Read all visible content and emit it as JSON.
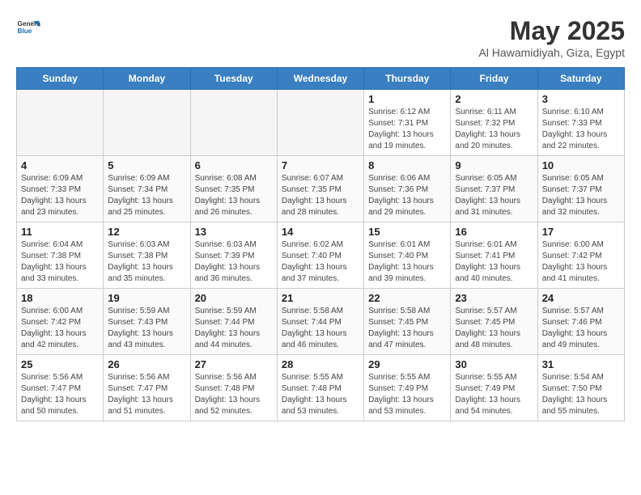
{
  "header": {
    "logo_general": "General",
    "logo_blue": "Blue",
    "month_title": "May 2025",
    "location": "Al Hawamidiyah, Giza, Egypt"
  },
  "weekdays": [
    "Sunday",
    "Monday",
    "Tuesday",
    "Wednesday",
    "Thursday",
    "Friday",
    "Saturday"
  ],
  "weeks": [
    [
      {
        "day": "",
        "empty": true
      },
      {
        "day": "",
        "empty": true
      },
      {
        "day": "",
        "empty": true
      },
      {
        "day": "",
        "empty": true
      },
      {
        "day": "1",
        "sunrise": "6:12 AM",
        "sunset": "7:31 PM",
        "daylight": "13 hours and 19 minutes."
      },
      {
        "day": "2",
        "sunrise": "6:11 AM",
        "sunset": "7:32 PM",
        "daylight": "13 hours and 20 minutes."
      },
      {
        "day": "3",
        "sunrise": "6:10 AM",
        "sunset": "7:33 PM",
        "daylight": "13 hours and 22 minutes."
      }
    ],
    [
      {
        "day": "4",
        "sunrise": "6:09 AM",
        "sunset": "7:33 PM",
        "daylight": "13 hours and 23 minutes."
      },
      {
        "day": "5",
        "sunrise": "6:09 AM",
        "sunset": "7:34 PM",
        "daylight": "13 hours and 25 minutes."
      },
      {
        "day": "6",
        "sunrise": "6:08 AM",
        "sunset": "7:35 PM",
        "daylight": "13 hours and 26 minutes."
      },
      {
        "day": "7",
        "sunrise": "6:07 AM",
        "sunset": "7:35 PM",
        "daylight": "13 hours and 28 minutes."
      },
      {
        "day": "8",
        "sunrise": "6:06 AM",
        "sunset": "7:36 PM",
        "daylight": "13 hours and 29 minutes."
      },
      {
        "day": "9",
        "sunrise": "6:05 AM",
        "sunset": "7:37 PM",
        "daylight": "13 hours and 31 minutes."
      },
      {
        "day": "10",
        "sunrise": "6:05 AM",
        "sunset": "7:37 PM",
        "daylight": "13 hours and 32 minutes."
      }
    ],
    [
      {
        "day": "11",
        "sunrise": "6:04 AM",
        "sunset": "7:38 PM",
        "daylight": "13 hours and 33 minutes."
      },
      {
        "day": "12",
        "sunrise": "6:03 AM",
        "sunset": "7:38 PM",
        "daylight": "13 hours and 35 minutes."
      },
      {
        "day": "13",
        "sunrise": "6:03 AM",
        "sunset": "7:39 PM",
        "daylight": "13 hours and 36 minutes."
      },
      {
        "day": "14",
        "sunrise": "6:02 AM",
        "sunset": "7:40 PM",
        "daylight": "13 hours and 37 minutes."
      },
      {
        "day": "15",
        "sunrise": "6:01 AM",
        "sunset": "7:40 PM",
        "daylight": "13 hours and 39 minutes."
      },
      {
        "day": "16",
        "sunrise": "6:01 AM",
        "sunset": "7:41 PM",
        "daylight": "13 hours and 40 minutes."
      },
      {
        "day": "17",
        "sunrise": "6:00 AM",
        "sunset": "7:42 PM",
        "daylight": "13 hours and 41 minutes."
      }
    ],
    [
      {
        "day": "18",
        "sunrise": "6:00 AM",
        "sunset": "7:42 PM",
        "daylight": "13 hours and 42 minutes."
      },
      {
        "day": "19",
        "sunrise": "5:59 AM",
        "sunset": "7:43 PM",
        "daylight": "13 hours and 43 minutes."
      },
      {
        "day": "20",
        "sunrise": "5:59 AM",
        "sunset": "7:44 PM",
        "daylight": "13 hours and 44 minutes."
      },
      {
        "day": "21",
        "sunrise": "5:58 AM",
        "sunset": "7:44 PM",
        "daylight": "13 hours and 46 minutes."
      },
      {
        "day": "22",
        "sunrise": "5:58 AM",
        "sunset": "7:45 PM",
        "daylight": "13 hours and 47 minutes."
      },
      {
        "day": "23",
        "sunrise": "5:57 AM",
        "sunset": "7:45 PM",
        "daylight": "13 hours and 48 minutes."
      },
      {
        "day": "24",
        "sunrise": "5:57 AM",
        "sunset": "7:46 PM",
        "daylight": "13 hours and 49 minutes."
      }
    ],
    [
      {
        "day": "25",
        "sunrise": "5:56 AM",
        "sunset": "7:47 PM",
        "daylight": "13 hours and 50 minutes."
      },
      {
        "day": "26",
        "sunrise": "5:56 AM",
        "sunset": "7:47 PM",
        "daylight": "13 hours and 51 minutes."
      },
      {
        "day": "27",
        "sunrise": "5:56 AM",
        "sunset": "7:48 PM",
        "daylight": "13 hours and 52 minutes."
      },
      {
        "day": "28",
        "sunrise": "5:55 AM",
        "sunset": "7:48 PM",
        "daylight": "13 hours and 53 minutes."
      },
      {
        "day": "29",
        "sunrise": "5:55 AM",
        "sunset": "7:49 PM",
        "daylight": "13 hours and 53 minutes."
      },
      {
        "day": "30",
        "sunrise": "5:55 AM",
        "sunset": "7:49 PM",
        "daylight": "13 hours and 54 minutes."
      },
      {
        "day": "31",
        "sunrise": "5:54 AM",
        "sunset": "7:50 PM",
        "daylight": "13 hours and 55 minutes."
      }
    ]
  ]
}
